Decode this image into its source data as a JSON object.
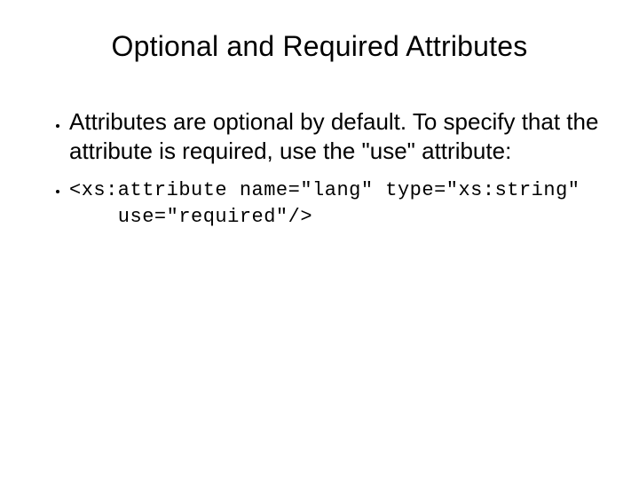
{
  "slide": {
    "title": "Optional and Required Attributes",
    "bullets": [
      {
        "kind": "text",
        "text": "Attributes are optional by default. To specify that the attribute is required, use the \"use\" attribute:"
      },
      {
        "kind": "code",
        "text": "<xs:attribute name=\"lang\" type=\"xs:string\"\n    use=\"required\"/>"
      }
    ]
  }
}
